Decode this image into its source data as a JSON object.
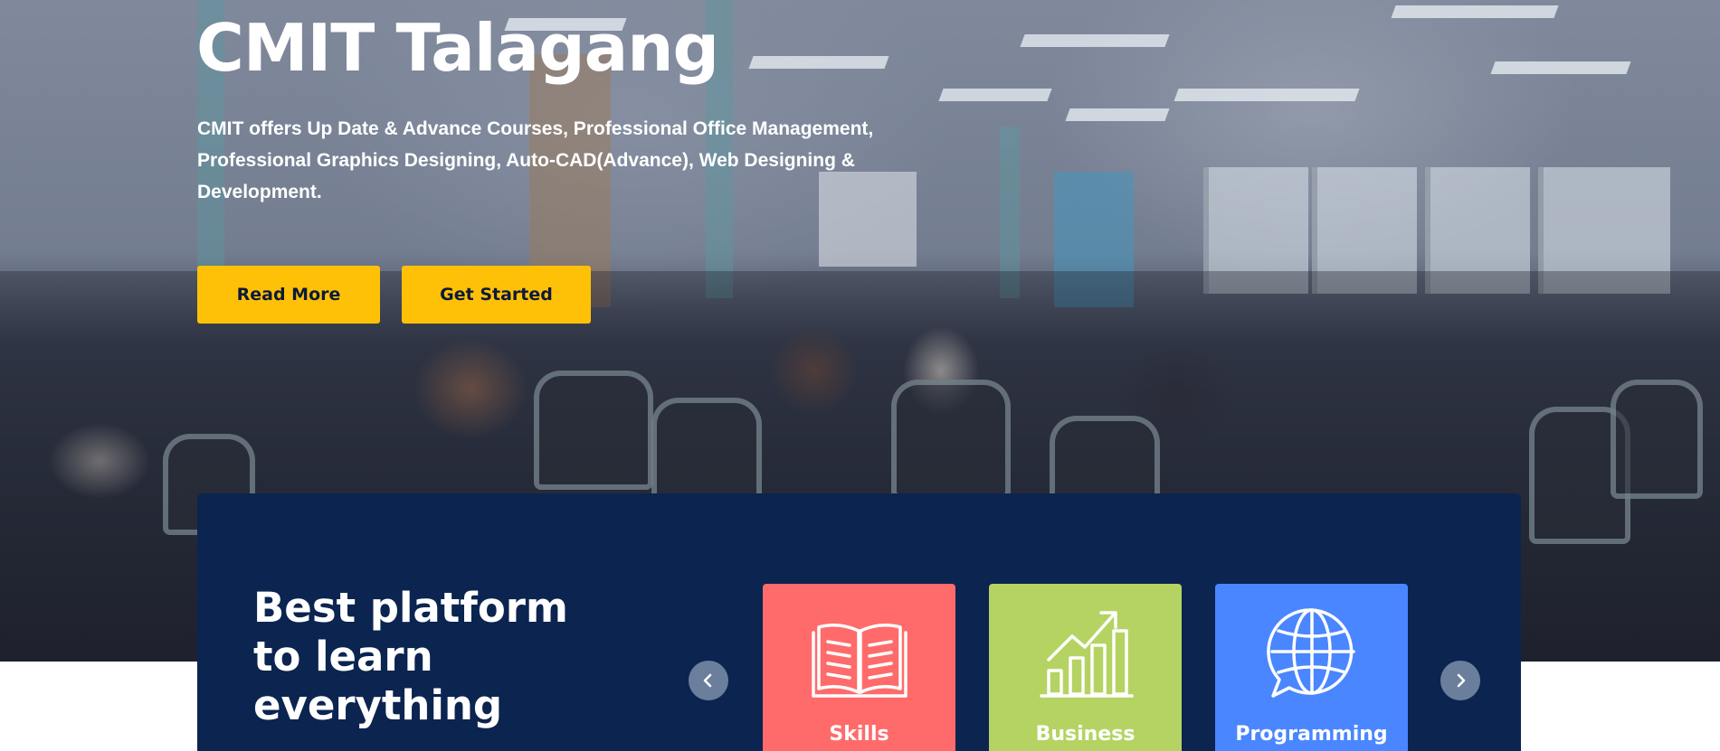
{
  "hero": {
    "title": "CMIT Talagang",
    "description": "CMIT offers Up Date & Advance Courses, Professional Office Management, Professional Graphics Designing, Auto-CAD(Advance), Web Designing & Development.",
    "buttons": {
      "read_more": "Read More",
      "get_started": "Get Started"
    },
    "button_color": "#ffc107"
  },
  "features": {
    "heading": "Best platform to learn everything",
    "panel_color": "#0b2450",
    "nav": {
      "prev_icon": "chevron-left-icon",
      "next_icon": "chevron-right-icon"
    },
    "cards": [
      {
        "label": "Skills",
        "icon": "open-book-icon",
        "color": "#ff6b6b"
      },
      {
        "label": "Business",
        "icon": "growth-chart-icon",
        "color": "#b5d362"
      },
      {
        "label": "Programming",
        "icon": "globe-chat-icon",
        "color": "#4a86ff"
      }
    ]
  }
}
